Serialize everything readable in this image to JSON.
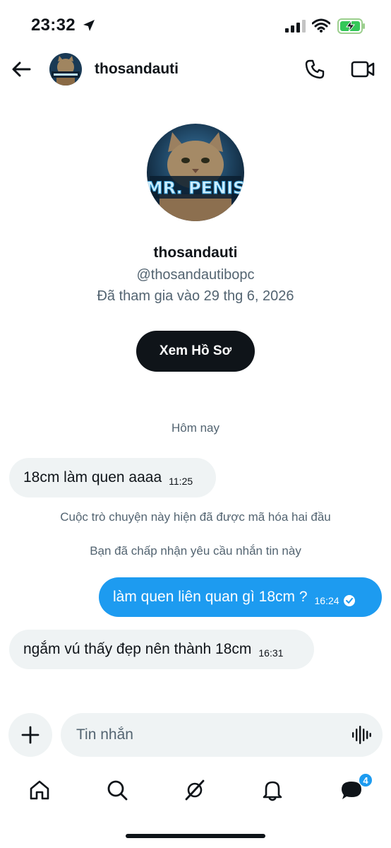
{
  "status_bar": {
    "time": "23:32",
    "icons": [
      "location-arrow-icon",
      "cellular-signal-icon",
      "wifi-icon",
      "battery-charging-icon"
    ]
  },
  "header": {
    "back_icon": "arrow-left-icon",
    "name": "thosandauti",
    "call_icon": "phone-icon",
    "video_icon": "video-camera-icon"
  },
  "profile": {
    "name": "thosandauti",
    "handle": "@thosandautibopc",
    "joined": "Đã tham gia vào 29 thg 6, 2026",
    "view_button": "Xem Hồ Sơ",
    "avatar_text": "MR. PENIS"
  },
  "conversation": {
    "day_label": "Hôm nay",
    "messages": [
      {
        "direction": "in",
        "text": "18cm làm quen aaaa",
        "time": "11:25"
      },
      {
        "direction": "out",
        "text": "làm quen liên quan gì 18cm ?",
        "time": "16:24",
        "read": true
      },
      {
        "direction": "in",
        "text": "ngắm vú thấy đẹp nên thành 18cm",
        "time": "16:31"
      }
    ],
    "notes": [
      "Cuộc trò chuyện này hiện đã được mã hóa hai đầu",
      "Bạn đã chấp nhận yêu cầu nhắn tin này"
    ]
  },
  "composer": {
    "add_icon": "plus-icon",
    "placeholder": "Tin nhắn",
    "voice_icon": "voice-waveform-icon"
  },
  "nav": {
    "items": [
      "home-icon",
      "search-icon",
      "grok-icon",
      "bell-icon",
      "messages-icon"
    ],
    "messages_badge": "4"
  },
  "colors": {
    "accent": "#1d9bf0",
    "text": "#0f1419",
    "secondary": "#536471",
    "bubble_in": "#eff3f4"
  }
}
